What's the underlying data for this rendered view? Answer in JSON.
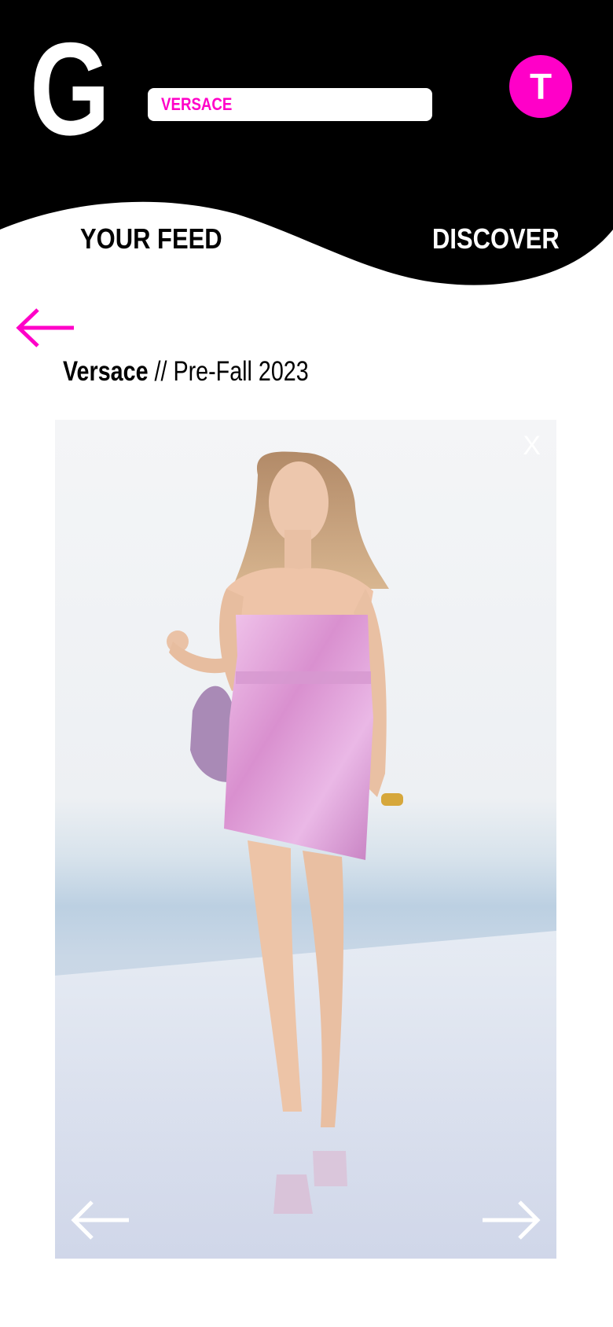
{
  "header": {
    "logo": "G",
    "search": {
      "value": "VERSACE",
      "placeholder": ""
    },
    "avatar_initial": "T",
    "tabs": [
      {
        "label": "YOUR FEED"
      },
      {
        "label": "DISCOVER"
      }
    ]
  },
  "collection": {
    "brand": "Versace",
    "separator": " // ",
    "season": "Pre-Fall 2023"
  },
  "viewer": {
    "close_label": "X"
  },
  "icons": {
    "back": "arrow-left-icon",
    "prev": "arrow-left-icon",
    "next": "arrow-right-icon"
  },
  "colors": {
    "accent": "#ff00c8",
    "header_bg": "#000000",
    "dress": "#e7a8dc"
  }
}
